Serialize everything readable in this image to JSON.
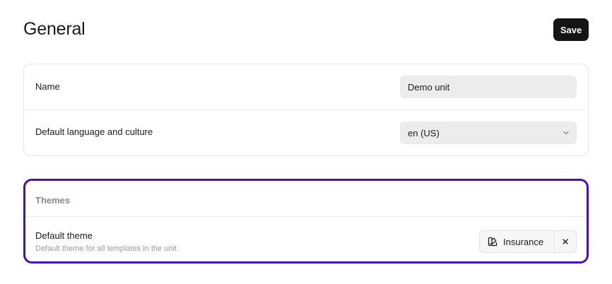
{
  "header": {
    "title": "General",
    "save_label": "Save"
  },
  "general_settings": {
    "name_label": "Name",
    "name_value": "Demo unit",
    "language_label": "Default language and culture",
    "language_value": "en (US)"
  },
  "themes": {
    "section_title": "Themes",
    "default_theme_label": "Default theme",
    "default_theme_description": "Default theme for all templates in the unit",
    "selected_theme": "Insurance"
  },
  "colors": {
    "highlight_border": "#4a0fb8",
    "save_button_bg": "#151515"
  },
  "icons": {
    "theme_chip": "palette-icon",
    "remove": "close-icon",
    "select": "chevron-down-icon"
  }
}
